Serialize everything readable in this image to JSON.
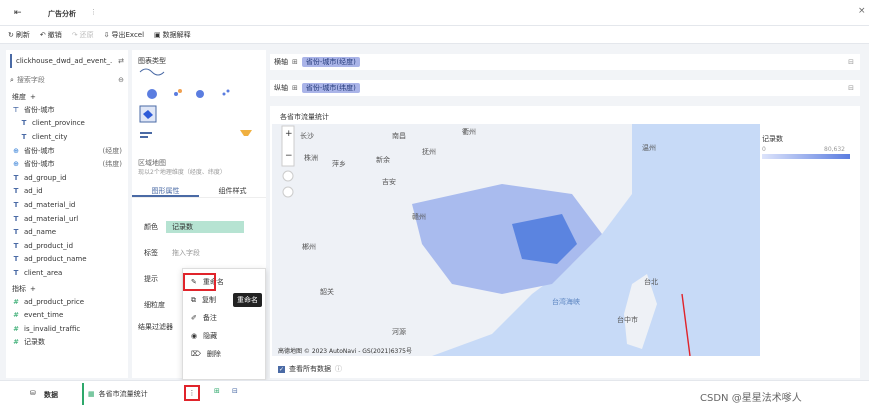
{
  "header": {
    "tab_title": "广告分析"
  },
  "toolbar": {
    "refresh": "刷新",
    "undo": "撤销",
    "redo": "还原",
    "export": "导出Excel",
    "explain": "数据解释"
  },
  "left_panel": {
    "dataset": "clickhouse_dwd_ad_event_...",
    "search_placeholder": "搜索字段",
    "dimension_header": "维度",
    "dimensions": [
      {
        "name": "省份-城市",
        "icon": "hierarchy-icon",
        "role": ""
      },
      {
        "name": "client_province",
        "icon": "text-icon",
        "role": ""
      },
      {
        "name": "client_city",
        "icon": "text-icon",
        "role": ""
      },
      {
        "name": "省份-城市",
        "icon": "geo-icon",
        "role": "(经度)"
      },
      {
        "name": "省份-城市",
        "icon": "geo-icon",
        "role": "(纬度)"
      },
      {
        "name": "ad_group_id",
        "icon": "text-icon",
        "role": ""
      },
      {
        "name": "ad_id",
        "icon": "text-icon",
        "role": ""
      },
      {
        "name": "ad_material_id",
        "icon": "text-icon",
        "role": ""
      },
      {
        "name": "ad_material_url",
        "icon": "text-icon",
        "role": ""
      },
      {
        "name": "ad_name",
        "icon": "text-icon",
        "role": ""
      },
      {
        "name": "ad_product_id",
        "icon": "text-icon",
        "role": ""
      },
      {
        "name": "ad_product_name",
        "icon": "text-icon",
        "role": ""
      },
      {
        "name": "client_area",
        "icon": "text-icon",
        "role": ""
      }
    ],
    "measure_header": "指标",
    "measures": [
      {
        "name": "ad_product_price",
        "icon": "hash-icon"
      },
      {
        "name": "event_time",
        "icon": "hash-icon"
      },
      {
        "name": "is_invalid_traffic",
        "icon": "hash-icon"
      },
      {
        "name": "记录数",
        "icon": "hash-icon"
      }
    ]
  },
  "mid_panel": {
    "chart_type_label": "图表类型",
    "map_caption": "区域地图",
    "map_hint": "现以2个地理维度（经度、纬度）",
    "tabs": [
      "图形属性",
      "组件样式"
    ],
    "props": [
      {
        "label": "颜色",
        "value": "记录数"
      },
      {
        "label": "标签",
        "value": "拖入字段"
      },
      {
        "label": "提示",
        "value": ""
      },
      {
        "label": "细粒度",
        "value": ""
      }
    ],
    "filter_label": "结果过滤器"
  },
  "context_menu": {
    "items": [
      "重命名",
      "复制",
      "备注",
      "隐藏",
      "删除"
    ],
    "tooltip": "重命名"
  },
  "axes": {
    "x_label": "横轴",
    "x_chip": "省份-城市(经度)",
    "y_label": "纵轴",
    "y_chip": "省份-城市(纬度)"
  },
  "map": {
    "title": "各省市流量统计",
    "legend_title": "记录数",
    "legend_min": "0",
    "legend_max": "80,632",
    "cities": [
      "长沙",
      "南昌",
      "衢州",
      "温州",
      "株洲",
      "萍乡",
      "新余",
      "抚州",
      "吉安",
      "赣州",
      "郴州",
      "韶关",
      "河源",
      "台湾海峡",
      "台北",
      "台中市"
    ],
    "attribution": "高德地图  © 2023 AutoNavi - GS(2021)6375号",
    "show_all": "查看所有数据"
  },
  "bottom_bar": {
    "data_tab": "数据",
    "sheet_tab": "各省市流量统计",
    "watermark": "CSDN @星星法术嗲人"
  }
}
